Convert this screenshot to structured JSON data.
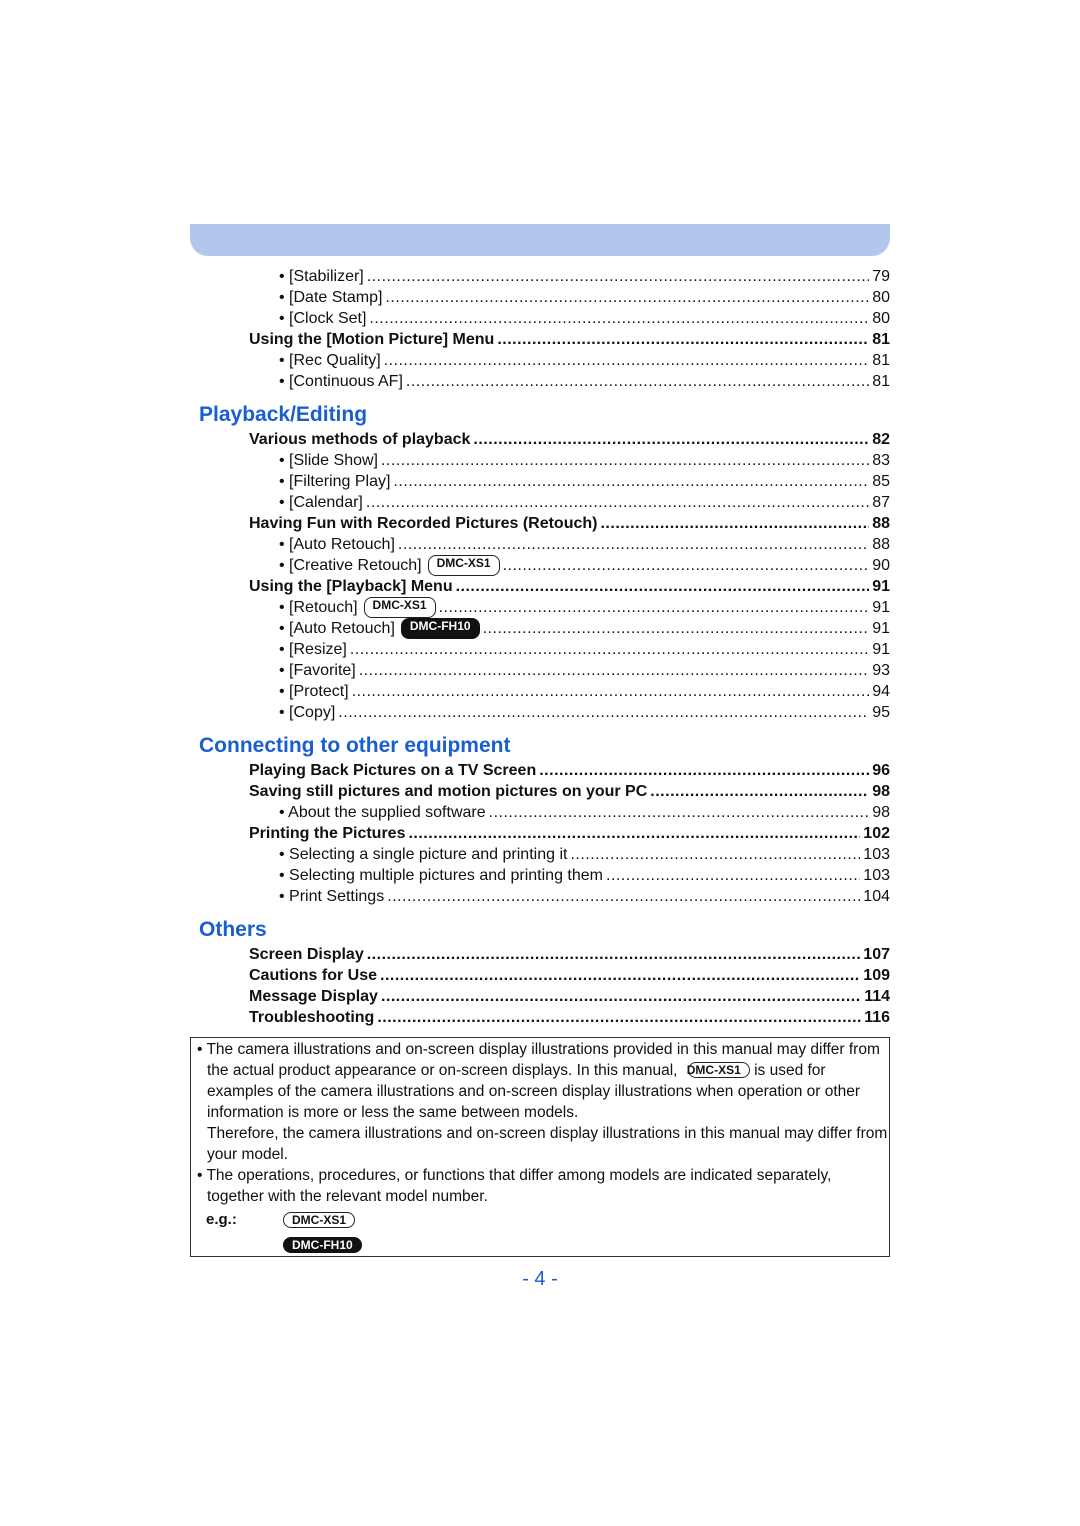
{
  "colors": {
    "header_bar": "#b3c6ec",
    "section_heading": "#1a5fd0"
  },
  "toc": {
    "intro": [
      {
        "label": "• [Stabilizer]",
        "page": "79",
        "level": 2
      },
      {
        "label": "• [Date Stamp]",
        "page": "80",
        "level": 2
      },
      {
        "label": "• [Clock Set]",
        "page": "80",
        "level": 2
      },
      {
        "label": "Using the [Motion Picture] Menu",
        "page": "81",
        "level": 1
      },
      {
        "label": "• [Rec Quality]",
        "page": "81",
        "level": 2
      },
      {
        "label": "• [Continuous AF]",
        "page": "81",
        "level": 2
      }
    ],
    "sections": [
      {
        "title": "Playback/Editing",
        "entries": [
          {
            "label": "Various methods of playback",
            "page": "82",
            "level": 1
          },
          {
            "label": "• [Slide Show]",
            "page": "83",
            "level": 2
          },
          {
            "label": "• [Filtering Play]",
            "page": "85",
            "level": 2
          },
          {
            "label": "• [Calendar]",
            "page": "87",
            "level": 2
          },
          {
            "label": "Having Fun with Recorded Pictures (Retouch)",
            "page": "88",
            "level": 1
          },
          {
            "label": "• [Auto Retouch]",
            "page": "88",
            "level": 2
          },
          {
            "label": "• [Creative Retouch]",
            "badge": "DMC-XS1",
            "badge_style": "outline",
            "page": "90",
            "level": 2
          },
          {
            "label": "Using the [Playback] Menu",
            "page": "91",
            "level": 1
          },
          {
            "label": "• [Retouch]",
            "badge": "DMC-XS1",
            "badge_style": "outline",
            "page": "91",
            "level": 2
          },
          {
            "label": "• [Auto Retouch]",
            "badge": "DMC-FH10",
            "badge_style": "filled",
            "page": "91",
            "level": 2
          },
          {
            "label": "• [Resize]",
            "page": "91",
            "level": 2
          },
          {
            "label": "• [Favorite]",
            "page": "93",
            "level": 2
          },
          {
            "label": "• [Protect]",
            "page": "94",
            "level": 2
          },
          {
            "label": "• [Copy]",
            "page": "95",
            "level": 2
          }
        ]
      },
      {
        "title": "Connecting to other equipment",
        "entries": [
          {
            "label": "Playing Back Pictures on a TV Screen",
            "page": "96",
            "level": 1
          },
          {
            "label": "Saving still pictures and motion pictures on your PC",
            "page": "98",
            "level": 1
          },
          {
            "label": "• About the supplied software",
            "page": "98",
            "level": 2
          },
          {
            "label": "Printing the Pictures",
            "page": "102",
            "level": 1
          },
          {
            "label": "• Selecting a single picture and printing it",
            "page": "103",
            "level": 2
          },
          {
            "label": "• Selecting multiple pictures and printing them",
            "page": "103",
            "level": 2
          },
          {
            "label": "• Print Settings",
            "page": "104",
            "level": 2
          }
        ]
      },
      {
        "title": "Others",
        "entries": [
          {
            "label": "Screen Display",
            "page": "107",
            "level": 1
          },
          {
            "label": "Cautions for Use",
            "page": "109",
            "level": 1
          },
          {
            "label": "Message Display",
            "page": "114",
            "level": 1
          },
          {
            "label": "Troubleshooting",
            "page": "116",
            "level": 1
          }
        ]
      }
    ]
  },
  "note": {
    "p1_a": "• The camera illustrations and on-screen display illustrations provided in this manual may differ from the actual product appearance or on-screen displays. In this manual, ",
    "p1_badge": "DMC-XS1",
    "p1_b": " is used for examples of the camera illustrations and on-screen display illustrations when operation or other information is more or less the same between models.",
    "p2": "Therefore, the camera illustrations and on-screen display illustrations in this manual may differ from your model.",
    "p3": "• The operations, procedures, or functions that differ among models are indicated separately, together with the relevant model number.",
    "eg_label": "e.g.:",
    "eg_badge_1": "DMC-XS1",
    "eg_badge_2": "DMC-FH10"
  },
  "page_number": "- 4 -"
}
